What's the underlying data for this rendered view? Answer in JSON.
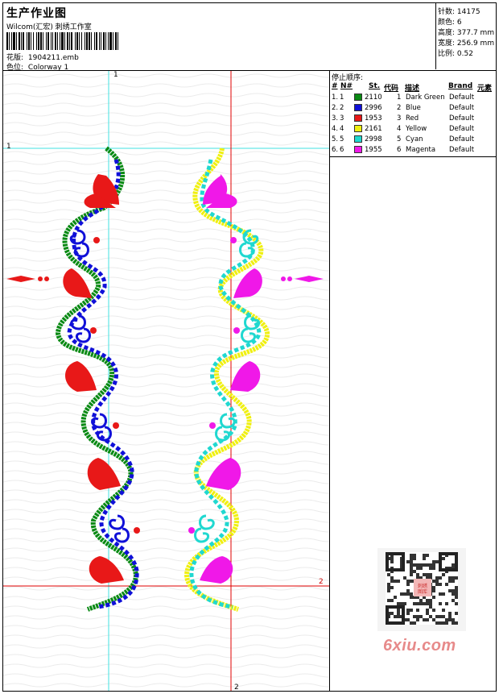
{
  "header": {
    "title": "生产作业图",
    "company": "Wilcom(汇宏) 刺绣工作室",
    "design_label": "花版:",
    "design_value": "1904211.emb",
    "colorway_label": "色位:",
    "colorway_value": "Colorway 1"
  },
  "info": {
    "stitches_label": "针数:",
    "stitches_value": "14175",
    "colors_label": "颜色:",
    "colors_value": "6",
    "height_label": "高度:",
    "height_value": "377.7 mm",
    "width_label": "宽度:",
    "width_value": "256.9 mm",
    "scale_label": "比例:",
    "scale_value": "0.52"
  },
  "sequence": {
    "title": "停止顺序:",
    "headers": [
      "#",
      "N#",
      "St.",
      "代码",
      "描述",
      "Brand",
      "元素"
    ],
    "rows": [
      {
        "num": "1.",
        "n": "1",
        "code": "2110",
        "idx": "1",
        "desc": "Dark Green",
        "brand": "Default",
        "color": "#0a8a14"
      },
      {
        "num": "2.",
        "n": "2",
        "code": "2996",
        "idx": "2",
        "desc": "Blue",
        "brand": "Default",
        "color": "#1010d8"
      },
      {
        "num": "3.",
        "n": "3",
        "code": "1953",
        "idx": "3",
        "desc": "Red",
        "brand": "Default",
        "color": "#e81818"
      },
      {
        "num": "4.",
        "n": "4",
        "code": "2161",
        "idx": "4",
        "desc": "Yellow",
        "brand": "Default",
        "color": "#f0f010"
      },
      {
        "num": "5.",
        "n": "5",
        "code": "2998",
        "idx": "5",
        "desc": "Cyan",
        "brand": "Default",
        "color": "#20d8d0"
      },
      {
        "num": "6.",
        "n": "6",
        "code": "1955",
        "idx": "6",
        "desc": "Magenta",
        "brand": "Default",
        "color": "#f018e8"
      }
    ]
  },
  "guides": {
    "v1_label": "1",
    "h1_label": "1",
    "v2_label": "2",
    "h2_label": "2"
  },
  "watermark": {
    "site": "6xiu.com",
    "qr_badge": "刺绣 图库"
  },
  "colors": {
    "green": "#0a8a14",
    "blue": "#1010d8",
    "red": "#e81818",
    "yellow": "#f0f010",
    "cyan": "#20d8d0",
    "magenta": "#f018e8",
    "guide_cyan": "#40e0e0",
    "guide_red": "#e00000"
  }
}
